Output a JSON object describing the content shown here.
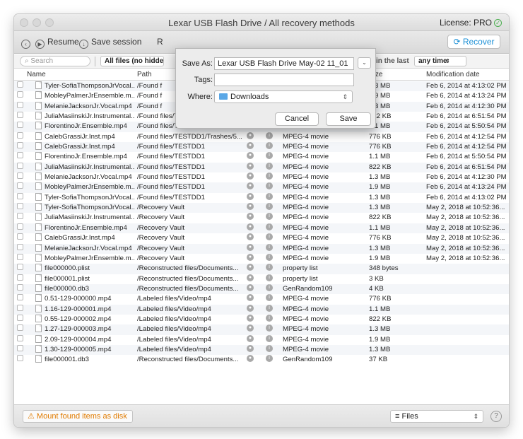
{
  "window": {
    "title": "Lexar USB Flash Drive / All recovery methods",
    "license": "License: PRO"
  },
  "toolbar": {
    "resume": "Resume",
    "save_session": "Save session",
    "recover": "Recover"
  },
  "filter": {
    "search_placeholder": "Search",
    "files_filter": "All files (no hidden",
    "within_label": "within the last",
    "time_range": "any time"
  },
  "columns": {
    "name": "Name",
    "path": "Path",
    "size": "Size",
    "modified": "Modification date"
  },
  "rows": [
    {
      "name": "Tyler-SofiaThompsonJrVocal...",
      "path": "/Found f",
      "kind": "",
      "size": "1.3 MB",
      "date": "Feb 6, 2014 at 4:13:02 PM"
    },
    {
      "name": "MobleyPalmerJrEnsemble.m...",
      "path": "/Found f",
      "kind": "",
      "size": "1.9 MB",
      "date": "Feb 6, 2014 at 4:13:24 PM"
    },
    {
      "name": "MelanieJacksonJr.Vocal.mp4",
      "path": "/Found f",
      "kind": "",
      "size": "1.3 MB",
      "date": "Feb 6, 2014 at 4:12:30 PM"
    },
    {
      "name": "JuliaMasiinskiJr.Instrumental...",
      "path": "/Found files/TESTDD1/Trashes/5...",
      "kind": "MPEG-4 movie",
      "size": "822 KB",
      "date": "Feb 6, 2014 at 6:51:54 PM"
    },
    {
      "name": "FlorentinoJr.Ensemble.mp4",
      "path": "/Found files/TESTDD1/Trashes/5...",
      "kind": "MPEG-4 movie",
      "size": "1.1 MB",
      "date": "Feb 6, 2014 at 5:50:54 PM"
    },
    {
      "name": "CalebGrassiJr.Inst.mp4",
      "path": "/Found files/TESTDD1/Trashes/5...",
      "kind": "MPEG-4 movie",
      "size": "776 KB",
      "date": "Feb 6, 2014 at 4:12:54 PM"
    },
    {
      "name": "CalebGrassiJr.Inst.mp4",
      "path": "/Found files/TESTDD1",
      "kind": "MPEG-4 movie",
      "size": "776 KB",
      "date": "Feb 6, 2014 at 4:12:54 PM"
    },
    {
      "name": "FlorentinoJr.Ensemble.mp4",
      "path": "/Found files/TESTDD1",
      "kind": "MPEG-4 movie",
      "size": "1.1 MB",
      "date": "Feb 6, 2014 at 5:50:54 PM"
    },
    {
      "name": "JuliaMasiinskiJr.Instrumental...",
      "path": "/Found files/TESTDD1",
      "kind": "MPEG-4 movie",
      "size": "822 KB",
      "date": "Feb 6, 2014 at 6:51:54 PM"
    },
    {
      "name": "MelanieJacksonJr.Vocal.mp4",
      "path": "/Found files/TESTDD1",
      "kind": "MPEG-4 movie",
      "size": "1.3 MB",
      "date": "Feb 6, 2014 at 4:12:30 PM"
    },
    {
      "name": "MobleyPalmerJrEnsemble.m...",
      "path": "/Found files/TESTDD1",
      "kind": "MPEG-4 movie",
      "size": "1.9 MB",
      "date": "Feb 6, 2014 at 4:13:24 PM"
    },
    {
      "name": "Tyler-SofiaThompsonJrVocal...",
      "path": "/Found files/TESTDD1",
      "kind": "MPEG-4 movie",
      "size": "1.3 MB",
      "date": "Feb 6, 2014 at 4:13:02 PM"
    },
    {
      "name": "Tyler-SofiaThompsonJrVocal...",
      "path": "/Recovery Vault",
      "kind": "MPEG-4 movie",
      "size": "1.3 MB",
      "date": "May 2, 2018 at 10:52:36..."
    },
    {
      "name": "JuliaMasiinskiJr.Instrumental...",
      "path": "/Recovery Vault",
      "kind": "MPEG-4 movie",
      "size": "822 KB",
      "date": "May 2, 2018 at 10:52:36..."
    },
    {
      "name": "FlorentinoJr.Ensemble.mp4",
      "path": "/Recovery Vault",
      "kind": "MPEG-4 movie",
      "size": "1.1 MB",
      "date": "May 2, 2018 at 10:52:36..."
    },
    {
      "name": "CalebGrassiJr.Inst.mp4",
      "path": "/Recovery Vault",
      "kind": "MPEG-4 movie",
      "size": "776 KB",
      "date": "May 2, 2018 at 10:52:36..."
    },
    {
      "name": "MelanieJacksonJr.Vocal.mp4",
      "path": "/Recovery Vault",
      "kind": "MPEG-4 movie",
      "size": "1.3 MB",
      "date": "May 2, 2018 at 10:52:36..."
    },
    {
      "name": "MobleyPalmerJrEnsemble.m...",
      "path": "/Recovery Vault",
      "kind": "MPEG-4 movie",
      "size": "1.9 MB",
      "date": "May 2, 2018 at 10:52:36..."
    },
    {
      "name": "file000000.plist",
      "path": "/Reconstructed files/Documents...",
      "kind": "property list",
      "size": "348 bytes",
      "date": ""
    },
    {
      "name": "file000001.plist",
      "path": "/Reconstructed files/Documents...",
      "kind": "property list",
      "size": "3 KB",
      "date": ""
    },
    {
      "name": "file000000.db3",
      "path": "/Reconstructed files/Documents...",
      "kind": "GenRandom109",
      "size": "4 KB",
      "date": ""
    },
    {
      "name": "0.51-129-000000.mp4",
      "path": "/Labeled files/Video/mp4",
      "kind": "MPEG-4 movie",
      "size": "776 KB",
      "date": ""
    },
    {
      "name": "1.16-129-000001.mp4",
      "path": "/Labeled files/Video/mp4",
      "kind": "MPEG-4 movie",
      "size": "1.1 MB",
      "date": ""
    },
    {
      "name": "0.55-129-000002.mp4",
      "path": "/Labeled files/Video/mp4",
      "kind": "MPEG-4 movie",
      "size": "822 KB",
      "date": ""
    },
    {
      "name": "1.27-129-000003.mp4",
      "path": "/Labeled files/Video/mp4",
      "kind": "MPEG-4 movie",
      "size": "1.3 MB",
      "date": ""
    },
    {
      "name": "2.09-129-000004.mp4",
      "path": "/Labeled files/Video/mp4",
      "kind": "MPEG-4 movie",
      "size": "1.9 MB",
      "date": ""
    },
    {
      "name": "1.30-129-000005.mp4",
      "path": "/Labeled files/Video/mp4",
      "kind": "MPEG-4 movie",
      "size": "1.3 MB",
      "date": ""
    },
    {
      "name": "file000001.db3",
      "path": "/Reconstructed files/Documents...",
      "kind": "GenRandom109",
      "size": "37 KB",
      "date": ""
    }
  ],
  "bottom": {
    "mount": "Mount found items as disk",
    "view": "Files",
    "help": "?"
  },
  "dialog": {
    "save_as_label": "Save As:",
    "save_as_value": "Lexar USB Flash Drive May-02 11_01",
    "tags_label": "Tags:",
    "tags_value": "",
    "where_label": "Where:",
    "where_value": "Downloads",
    "cancel": "Cancel",
    "save": "Save"
  },
  "icons": {
    "back": "back-icon",
    "resume": "play-icon",
    "save": "download-icon",
    "recover": "refresh-icon",
    "mount": "warning-icon",
    "list": "list-icon"
  },
  "colors": {
    "accent": "#1a8fd6",
    "warning": "#e07b00",
    "pro": "#4caf50"
  }
}
